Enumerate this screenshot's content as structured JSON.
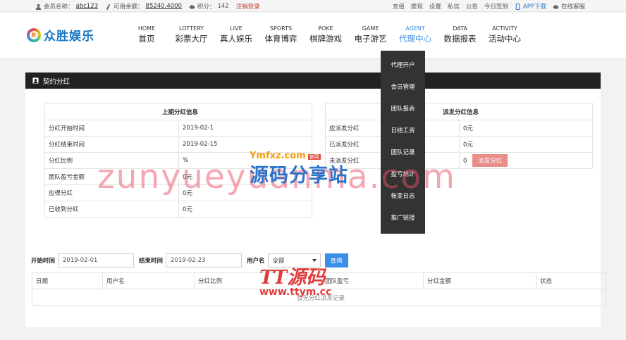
{
  "topbar": {
    "member_label": "会员名称：",
    "member_name": "abc123",
    "balance_label": "可用余额：",
    "balance": "85240.4000",
    "points_label": "积分：",
    "points": "142",
    "logout": "注销登录",
    "links": [
      "充值",
      "提现",
      "设置",
      "私信",
      "公告",
      "今日签到"
    ],
    "app_download": "APP下载",
    "service": "在线客服"
  },
  "header": {
    "logo_text": "众胜娱乐",
    "logo_badge": "胜",
    "nav": [
      {
        "en": "HOME",
        "cn": "首页"
      },
      {
        "en": "LOTTERY",
        "cn": "彩票大厅"
      },
      {
        "en": "LIVE",
        "cn": "真人娱乐"
      },
      {
        "en": "SPORTS",
        "cn": "体育博弈"
      },
      {
        "en": "POKE",
        "cn": "棋牌游戏"
      },
      {
        "en": "GAME",
        "cn": "电子游艺"
      },
      {
        "en": "AGENT",
        "cn": "代理中心"
      },
      {
        "en": "DATA",
        "cn": "数据报表"
      },
      {
        "en": "ACTIVITY",
        "cn": "活动中心"
      }
    ],
    "active_nav": "AGENT"
  },
  "dropdown": [
    "代理开户",
    "会员管理",
    "团队报表",
    "日结工资",
    "团队记录",
    "盈亏统计",
    "帐变日志",
    "推广链接"
  ],
  "panel": {
    "title": "契约分红",
    "last": {
      "heading": "上期分红信息",
      "rows": [
        {
          "label": "分红开始时间",
          "value": "2019-02-1"
        },
        {
          "label": "分红结束时间",
          "value": "2019-02-15"
        },
        {
          "label": "分红比例",
          "value": "%"
        },
        {
          "label": "团队盈亏金额",
          "value": "0元"
        },
        {
          "label": "应得分红",
          "value": "0元"
        },
        {
          "label": "已收到分红",
          "value": "0元"
        }
      ]
    },
    "dispatch": {
      "heading": "派发分红信息",
      "rows": [
        {
          "label": "应派发分红",
          "value": "0元"
        },
        {
          "label": "已派发分红",
          "value": "0元"
        },
        {
          "label": "未派发分红",
          "value": "0"
        }
      ],
      "button": "派发分红"
    }
  },
  "filter": {
    "start_label": "开始时间",
    "start_value": "2019-02-01",
    "end_label": "结束时间",
    "end_value": "2019-02-23",
    "user_label": "用户名",
    "user_select": "全部",
    "query_button": "查询"
  },
  "result_table": {
    "columns": [
      "日期",
      "用户名",
      "分红比例",
      "团队盈亏",
      "分红金额",
      "状态"
    ],
    "empty_text": "暂无分红派发记录"
  },
  "watermarks": {
    "big": "zunyueyuanma.com",
    "site_domain": "Ymfxz.com",
    "site_badge": "官网",
    "site_name": "源码分享站",
    "tt_title": "TT源码",
    "tt_domain": "www.ttym.cc"
  }
}
